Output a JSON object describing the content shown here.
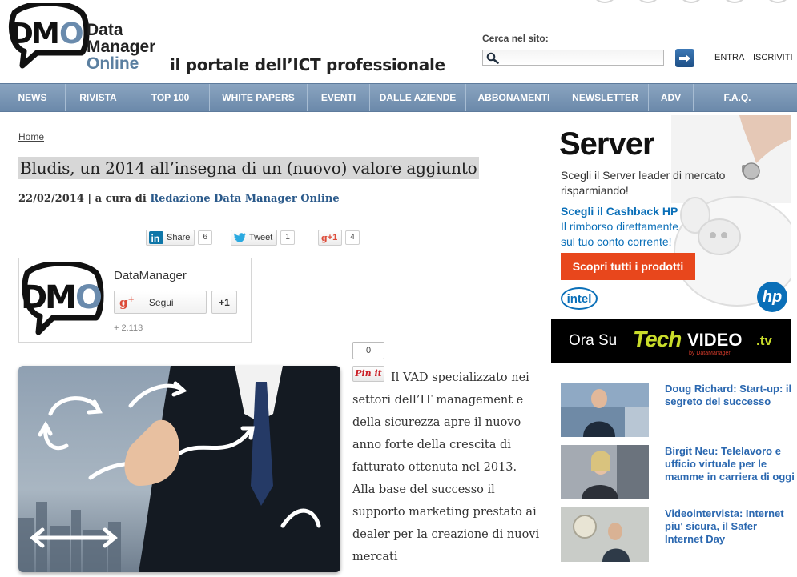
{
  "logo": {
    "abbr": "DMO",
    "line1": "Data",
    "line2": "Manager",
    "line3": "Online"
  },
  "tagline": "il portale dell’ICT professionale",
  "search": {
    "label": "Cerca nel sito:",
    "placeholder": "",
    "value": ""
  },
  "login": {
    "entra": "ENTRA",
    "iscriviti": "ISCRIVITI"
  },
  "nav": [
    {
      "label": "NEWS"
    },
    {
      "label": "RIVISTA"
    },
    {
      "label": "TOP 100"
    },
    {
      "label": "WHITE PAPERS"
    },
    {
      "label": "EVENTI"
    },
    {
      "label": "DALLE AZIENDE"
    },
    {
      "label": "ABBONAMENTI"
    },
    {
      "label": "NEWSLETTER"
    },
    {
      "label": "ADV"
    },
    {
      "label": "F.A.Q."
    }
  ],
  "breadcrumb": "Home",
  "article": {
    "title": "Bludis, un 2014 all’insegna di un (nuovo) valore aggiunto",
    "date": "22/02/2014",
    "by": " | a cura di ",
    "author": "Redazione Data Manager Online",
    "body": "Il VAD specializzato nei settori dell’IT management e della sicurezza apre il nuovo anno forte della crescita di fatturato ottenuta nel 2013. Alla base del successo il supporto marketing prestato ai dealer per la creazione di nuovi mercati"
  },
  "share": {
    "linkedin_label": "Share",
    "linkedin_count": "6",
    "twitter_label": "Tweet",
    "twitter_count": "1",
    "gplus_label": "+1",
    "gplus_count": "4"
  },
  "gplus_widget": {
    "name": "DataManager",
    "follow": "Segui",
    "plus_one": "+1",
    "followers": "+ 2.113"
  },
  "pinterest": {
    "count": "0",
    "label": "Pin it"
  },
  "ad_server": {
    "headline": "Server",
    "line1": "Scegli il Server leader di mercato",
    "line2": "risparmiando!",
    "cashback": "Scegli il Cashback HP",
    "line3": "Il rimborso direttamente",
    "line4": "sul tuo conto corrente!",
    "cta": "Scopri tutti i prodotti",
    "intel": "intel",
    "hp": "hp"
  },
  "ad_tech": {
    "ora_su": "Ora Su",
    "tech": "Tech",
    "video": "VIDEO",
    "tv": ".tv",
    "sub": "by DataManager"
  },
  "videos": [
    {
      "title": "Doug Richard: Start-up: il segreto del successo"
    },
    {
      "title": "Birgit Neu: Telelavoro e ufficio virtuale per le mamme in carriera di oggi"
    },
    {
      "title": "Videointervista: Internet piu' sicura, il Safer Internet Day"
    }
  ],
  "colors": {
    "nav": "#7a96b5",
    "accent_blue": "#2b68b0",
    "ad_orange": "#e8471c",
    "cashback_blue": "#0a6fb8"
  }
}
